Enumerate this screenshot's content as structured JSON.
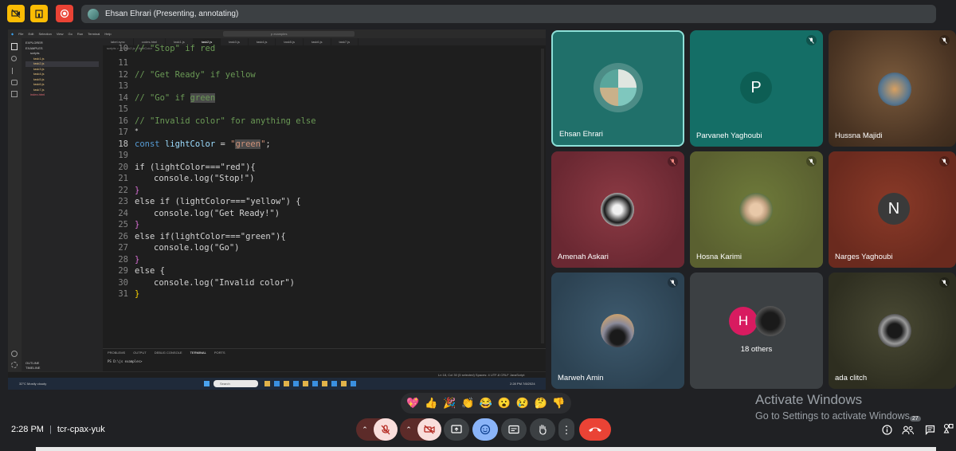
{
  "topbar": {
    "presenting_label": "Ehsan Ehrari (Presenting, annotating)"
  },
  "vscode": {
    "menu": [
      "File",
      "Edit",
      "Selection",
      "View",
      "Go",
      "Run",
      "Terminal",
      "Help"
    ],
    "search": "p examples",
    "explorer_title": "EXPLORER",
    "folder": "EXAMPLES",
    "files": [
      "scripts",
      "task1.js",
      "task2.js",
      "task3.js",
      "task4.js",
      "task5.js",
      "task6.js",
      "task7.js",
      "index.html"
    ],
    "tabs": [
      "label.sync",
      "codes.html",
      "task1.js",
      "task2.js",
      "task3.js",
      "task4.js",
      "task5.js",
      "task6.js",
      "task7.js"
    ],
    "breadcrumb": "scripts > JS task2.js > lightColor",
    "panel_tabs": [
      "PROBLEMS",
      "OUTPUT",
      "DEBUG CONSOLE",
      "TERMINAL",
      "PORTS"
    ],
    "terminal_line": "PS D:\\js examples>",
    "statusbar": "Ln 18, Col 30 (5 selected)   Spaces: 4   UTF-8   CRLF   JavaScript",
    "outline": "OUTLINE",
    "timeline": "TIMELINE",
    "weather": "32°C Mostly cloudy",
    "search_taskbar": "Search",
    "clock_small": "2:28 PM 7/8/2024"
  },
  "code_lines": [
    {
      "n": "10",
      "y": -6
    },
    {
      "n": "11"
    },
    {
      "n": "12"
    },
    {
      "n": "13"
    },
    {
      "n": "14"
    },
    {
      "n": "15"
    },
    {
      "n": "16"
    },
    {
      "n": "17"
    },
    {
      "n": "18"
    },
    {
      "n": "19"
    },
    {
      "n": "20"
    },
    {
      "n": "21"
    },
    {
      "n": "22"
    },
    {
      "n": "23"
    },
    {
      "n": "24"
    },
    {
      "n": "25"
    },
    {
      "n": "26"
    },
    {
      "n": "27"
    },
    {
      "n": "28"
    },
    {
      "n": "29"
    },
    {
      "n": "30"
    },
    {
      "n": "31"
    }
  ],
  "code_text": {
    "l10": "// \"Stop\" if red",
    "l12": "// \"Get Ready\" if yellow",
    "l14a": "// \"Go\" if ",
    "l14b": "green",
    "l16": "// \"Invalid color\" for anything else",
    "l17": "*",
    "l18_kw": "const",
    "l18_var": "lightColor",
    "l18_eq": " = ",
    "l18_q1": "\"",
    "l18_str": "green",
    "l18_q2": "\"",
    "l18_end": ";",
    "l20": "if (lightColor===\"red\"){",
    "l21": "console.log(\"Stop!\")",
    "l22": "}",
    "l23": "else if (lightColor===\"yellow\") {",
    "l24": "console.log(\"Get Ready!\")",
    "l25": "}",
    "l26": "else if(lightColor===\"green\"){",
    "l27": "console.log(\"Go\")",
    "l28": "}",
    "l29": "else {",
    "l30": "console.log(\"Invalid color\")",
    "l31": "}"
  },
  "participants": [
    {
      "name": "Ehsan Ehrari",
      "avatar": "logo"
    },
    {
      "name": "Parvaneh Yaghoubi",
      "avatar": "letter",
      "letter": "P",
      "muted": true
    },
    {
      "name": "Hussna Majidi",
      "avatar": "photo",
      "muted": true
    },
    {
      "name": "Amenah Askari",
      "avatar": "photo",
      "muted": true
    },
    {
      "name": "Hosna Karimi",
      "avatar": "photo",
      "muted": true
    },
    {
      "name": "Narges Yaghoubi",
      "avatar": "letter",
      "letter": "N",
      "muted": true
    },
    {
      "name": "Marweh Amin",
      "avatar": "photo",
      "muted": true
    },
    {
      "name": "18 others",
      "avatar": "group",
      "letter": "H"
    },
    {
      "name": "ada clitch",
      "avatar": "photo",
      "muted": true
    }
  ],
  "reactions": [
    "💖",
    "👍",
    "🎉",
    "👏",
    "😂",
    "😮",
    "😢",
    "🤔",
    "👎"
  ],
  "bottom": {
    "time": "2:28 PM",
    "separator": "|",
    "meeting_code": "tcr-cpax-yuk",
    "people_count": "27"
  },
  "watermark": {
    "line1": "Activate Windows",
    "line2": "Go to Settings to activate Windows."
  },
  "colors": {
    "end_call": "#ea4335",
    "muted_red": "#f28b82",
    "selected_tile_border": "#8ab4f8",
    "active_control": "#8ab4f8"
  }
}
